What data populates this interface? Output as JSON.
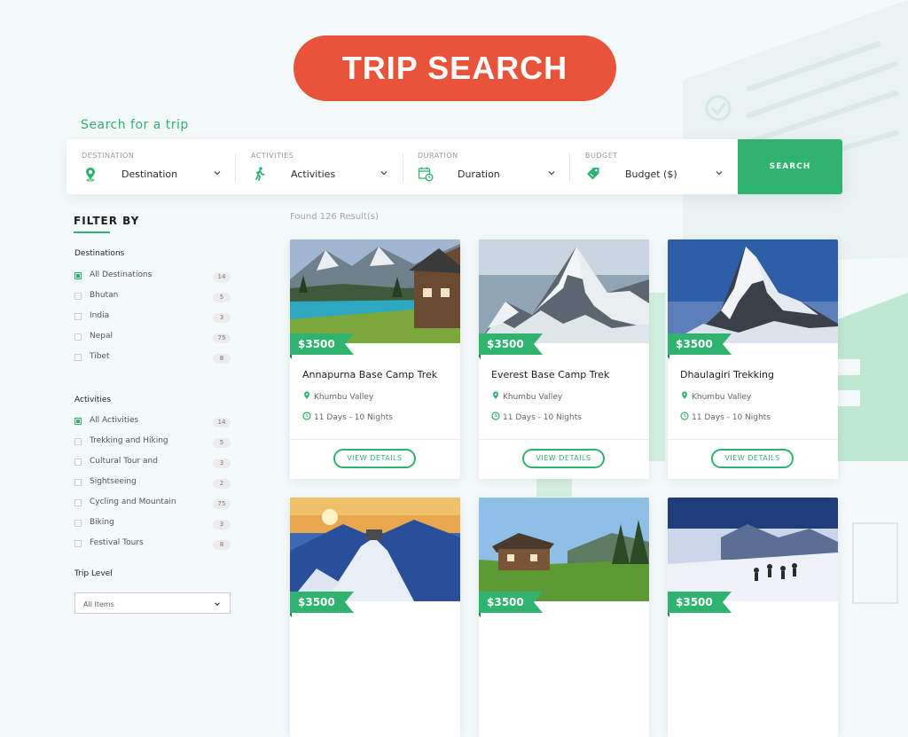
{
  "hero": {
    "title": "TRIP SEARCH"
  },
  "search": {
    "heading": "Search for a trip",
    "fields": [
      {
        "label": "DESTINATION",
        "value": "Destination",
        "icon": "map-pin-icon"
      },
      {
        "label": "ACTIVITIES",
        "value": "Activities",
        "icon": "hiker-icon"
      },
      {
        "label": "DURATION",
        "value": "Duration",
        "icon": "calendar-clock-icon"
      },
      {
        "label": "BUDGET",
        "value": "Budget ($)",
        "icon": "price-tag-icon"
      }
    ],
    "button": "SEARCH"
  },
  "filter": {
    "title": "FILTER BY",
    "destinations": {
      "title": "Destinations",
      "items": [
        {
          "label": "All Destinations",
          "count": "14",
          "checked": true
        },
        {
          "label": "Bhutan",
          "count": "5",
          "checked": false
        },
        {
          "label": "India",
          "count": "3",
          "checked": false
        },
        {
          "label": "Nepal",
          "count": "75",
          "checked": false
        },
        {
          "label": "Tibet",
          "count": "8",
          "checked": false
        }
      ]
    },
    "activities": {
      "title": "Activities",
      "items": [
        {
          "label": "All Activities",
          "count": "14",
          "checked": true
        },
        {
          "label": "Trekking and Hiking",
          "count": "5",
          "checked": false
        },
        {
          "label": "Cultural Tour and",
          "count": "3",
          "checked": false
        },
        {
          "label": "Sightseeing",
          "count": "2",
          "checked": false
        },
        {
          "label": "Cycling and Mountain",
          "count": "75",
          "checked": false
        },
        {
          "label": "Biking",
          "count": "3",
          "checked": false
        },
        {
          "label": "Festival Tours",
          "count": "8",
          "checked": false
        }
      ]
    },
    "trip_level": {
      "title": "Trip Level",
      "value": "All Items"
    }
  },
  "results": {
    "found": "Found 126 Result(s)",
    "cards": [
      {
        "price": "$3500",
        "title": "Annapurna Base Camp Trek",
        "location": "Khumbu Valley",
        "duration": "11 Days - 10 Nights",
        "button": "VIEW DETAILS",
        "image": "lake-chalet-photo"
      },
      {
        "price": "$3500",
        "title": "Everest Base Camp Trek",
        "location": "Khumbu Valley",
        "duration": "11 Days - 10 Nights",
        "button": "VIEW DETAILS",
        "image": "snow-peak-photo"
      },
      {
        "price": "$3500",
        "title": "Dhaulagiri Trekking",
        "location": "Khumbu Valley",
        "duration": "11 Days - 10 Nights",
        "button": "VIEW DETAILS",
        "image": "matterhorn-photo"
      },
      {
        "price": "$3500",
        "image": "sunset-summit-photo"
      },
      {
        "price": "$3500",
        "image": "alpine-hut-photo"
      },
      {
        "price": "$3500",
        "image": "climbers-snow-photo"
      }
    ]
  },
  "colors": {
    "accent": "#2fb36e",
    "hero": "#e8533a",
    "background": "#f4f9f9"
  }
}
